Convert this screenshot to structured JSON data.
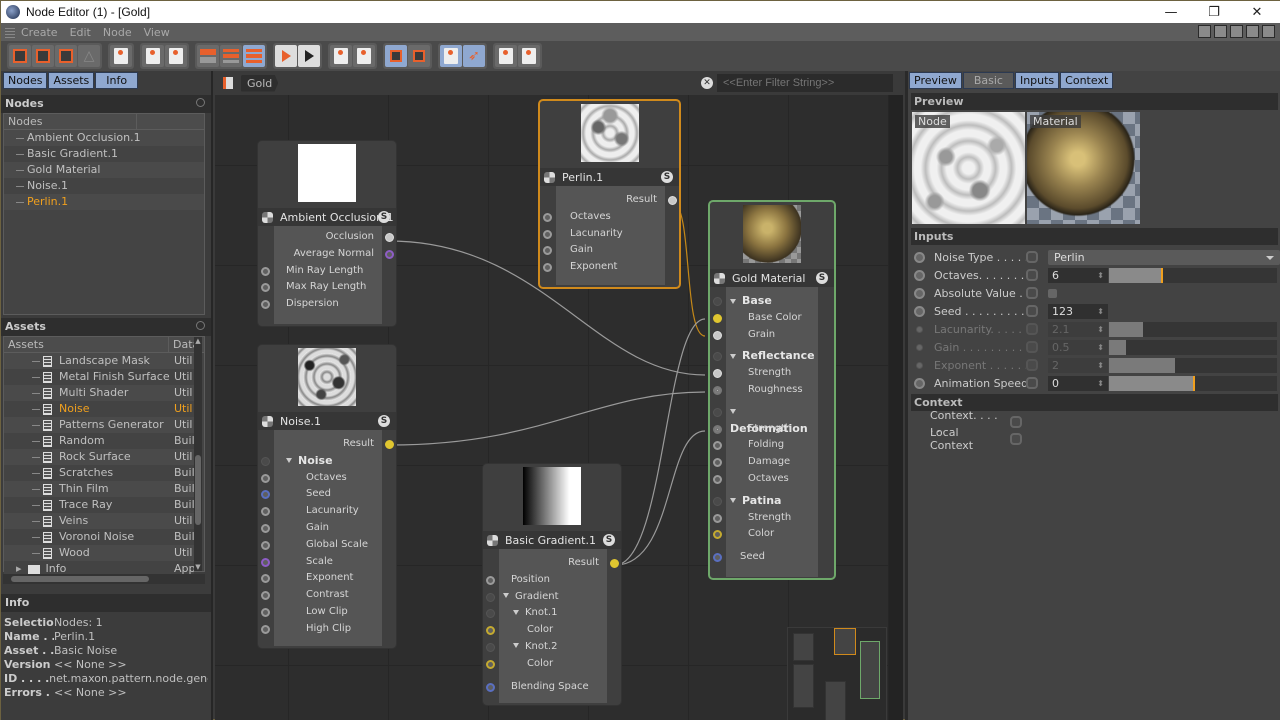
{
  "window": {
    "title": "Node Editor (1) - [Gold]",
    "controls": {
      "minimize": "—",
      "maximize": "❐",
      "close": "✕"
    }
  },
  "menu": [
    "Create",
    "Edit",
    "Node",
    "View"
  ],
  "toolbar": {
    "groups": [
      [
        "add-node-icon",
        "remove-node-icon",
        "replace-node-icon",
        "solo-icon"
      ],
      [
        "import-icon"
      ],
      [
        "group-nodes-icon",
        "ungroup-icon"
      ],
      [
        "collapse-all-icon",
        "collapse-partial-icon",
        "expand-all-icon"
      ],
      [
        "solo-play-icon",
        "play-icon"
      ],
      [
        "remove-port-icon",
        "add-port-icon"
      ],
      [
        "frame-selected-icon",
        "frame-reset-icon"
      ],
      [
        "frame-all-icon",
        "auto-arrange-icon"
      ],
      [
        "layout-h-icon",
        "layout-v-icon"
      ]
    ]
  },
  "left": {
    "tabs": [
      "Nodes",
      "Assets",
      "Info"
    ],
    "nodes_section": {
      "title": "Nodes",
      "column": "Nodes",
      "items": [
        {
          "label": "Ambient Occlusion.1",
          "selected": false
        },
        {
          "label": "Basic Gradient.1",
          "selected": false
        },
        {
          "label": "Gold Material",
          "selected": false
        },
        {
          "label": "Noise.1",
          "selected": false
        },
        {
          "label": "Perlin.1",
          "selected": true
        }
      ]
    },
    "assets_section": {
      "title": "Assets",
      "columns": [
        "Assets",
        "Data"
      ],
      "items": [
        {
          "label": "Landscape Mask",
          "data": "Util",
          "selected": false
        },
        {
          "label": "Metal Finish Surface",
          "data": "Util",
          "selected": false
        },
        {
          "label": "Multi Shader",
          "data": "Util",
          "selected": false
        },
        {
          "label": "Noise",
          "data": "Util",
          "selected": true
        },
        {
          "label": "Patterns Generator",
          "data": "Util",
          "selected": false
        },
        {
          "label": "Random",
          "data": "Buil",
          "selected": false
        },
        {
          "label": "Rock Surface",
          "data": "Util",
          "selected": false
        },
        {
          "label": "Scratches",
          "data": "Buil",
          "selected": false
        },
        {
          "label": "Thin Film",
          "data": "Buil",
          "selected": false
        },
        {
          "label": "Trace Ray",
          "data": "Buil",
          "selected": false
        },
        {
          "label": "Veins",
          "data": "Util",
          "selected": false
        },
        {
          "label": "Voronoi Noise",
          "data": "Buil",
          "selected": false
        },
        {
          "label": "Wood",
          "data": "Util",
          "selected": false
        }
      ],
      "folder": {
        "label": "Info",
        "data": "App"
      }
    },
    "info_section": {
      "title": "Info",
      "rows": [
        {
          "key": "Selection",
          "value": "Nodes: 1"
        },
        {
          "key": "Name . .",
          "value": "Perlin.1"
        },
        {
          "key": "Asset . .",
          "value": "Basic Noise"
        },
        {
          "key": "Version",
          "value": "<< None >>"
        },
        {
          "key": "ID . . . . .",
          "value": "net.maxon.pattern.node.genera"
        },
        {
          "key": "Errors . .",
          "value": "<< None >>"
        }
      ]
    }
  },
  "center": {
    "breadcrumb": "Gold",
    "filter_placeholder": "<<Enter Filter String>>",
    "nodes": {
      "ao": {
        "title": "Ambient Occlusion.1",
        "outputs": [
          "Occlusion",
          "Average Normal"
        ],
        "inputs": [
          "Min Ray Length",
          "Max Ray Length",
          "Dispersion"
        ]
      },
      "noise": {
        "title": "Noise.1",
        "output": "Result",
        "group": "Noise",
        "inputs": [
          "Octaves",
          "Seed",
          "Lacunarity",
          "Gain",
          "Global Scale",
          "Scale",
          "Exponent",
          "Contrast",
          "Low Clip",
          "High Clip"
        ]
      },
      "perlin": {
        "title": "Perlin.1",
        "output": "Result",
        "inputs": [
          "Octaves",
          "Lacunarity",
          "Gain",
          "Exponent"
        ]
      },
      "gradient": {
        "title": "Basic Gradient.1",
        "output": "Result",
        "rows": [
          "Position",
          "Gradient",
          "Knot.1",
          "Color",
          "Knot.2",
          "Color",
          "Blending Space"
        ]
      },
      "gold": {
        "title": "Gold Material",
        "groups": [
          {
            "name": "Base",
            "ports": [
              "Base Color",
              "Grain"
            ]
          },
          {
            "name": "Reflectance",
            "ports": [
              "Strength",
              "Roughness"
            ]
          },
          {
            "name": "Deformation",
            "ports": [
              "Strength",
              "Folding",
              "Damage",
              "Octaves"
            ]
          },
          {
            "name": "Patina",
            "ports": [
              "Strength",
              "Color"
            ]
          }
        ],
        "seed": "Seed"
      }
    },
    "badge": "S"
  },
  "right": {
    "tabs": [
      {
        "label": "Preview",
        "active": true
      },
      {
        "label": "Basic",
        "active": false
      },
      {
        "label": "Inputs",
        "active": true
      },
      {
        "label": "Context",
        "active": true
      }
    ],
    "preview": {
      "title": "Preview",
      "node_label": "Node",
      "material_label": "Material"
    },
    "inputs": {
      "title": "Inputs",
      "noise_type": {
        "label": "Noise Type . . . . . .",
        "value": "Perlin"
      },
      "params": [
        {
          "label": "Octaves. . . . . . . .",
          "value": "6",
          "fraction": 0.31,
          "marker": 0.31,
          "enabled": true
        },
        {
          "label": "Absolute Value . .",
          "checkbox": true,
          "enabled": true
        },
        {
          "label": "Seed . . . . . . . . .",
          "value": "123",
          "enabled": true
        },
        {
          "label": "Lacunarity. . . . . . .",
          "value": "2.1",
          "fraction": 0.2,
          "enabled": false
        },
        {
          "label": "Gain . . . . . . . . . .",
          "value": "0.5",
          "fraction": 0.1,
          "enabled": false
        },
        {
          "label": "Exponent . . . . . .",
          "value": "2",
          "fraction": 0.39,
          "enabled": false
        },
        {
          "label": "Animation Speed",
          "value": "0",
          "fraction": 0.5,
          "marker": 0.5,
          "enabled": true
        }
      ]
    },
    "context": {
      "title": "Context",
      "rows": [
        "Context. . . . . .",
        "Local Context"
      ]
    }
  }
}
